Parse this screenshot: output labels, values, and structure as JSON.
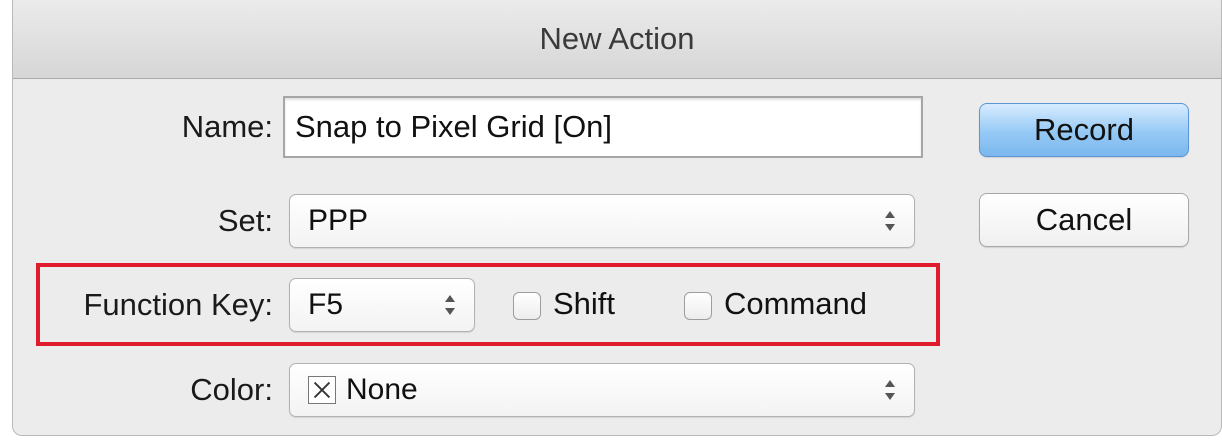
{
  "dialog": {
    "title": "New Action"
  },
  "form": {
    "name_label": "Name:",
    "name_value": "Snap to Pixel Grid [On]",
    "set_label": "Set:",
    "set_value": "PPP",
    "function_key_label": "Function Key:",
    "function_key_value": "F5",
    "shift_label": "Shift",
    "shift_checked": false,
    "command_label": "Command",
    "command_checked": false,
    "color_label": "Color:",
    "color_value": "None",
    "color_icon": "no-color-x-icon"
  },
  "buttons": {
    "record_label": "Record",
    "cancel_label": "Cancel"
  },
  "colors": {
    "highlight": "#e01b2d",
    "default_button": "#7bb8ee"
  }
}
